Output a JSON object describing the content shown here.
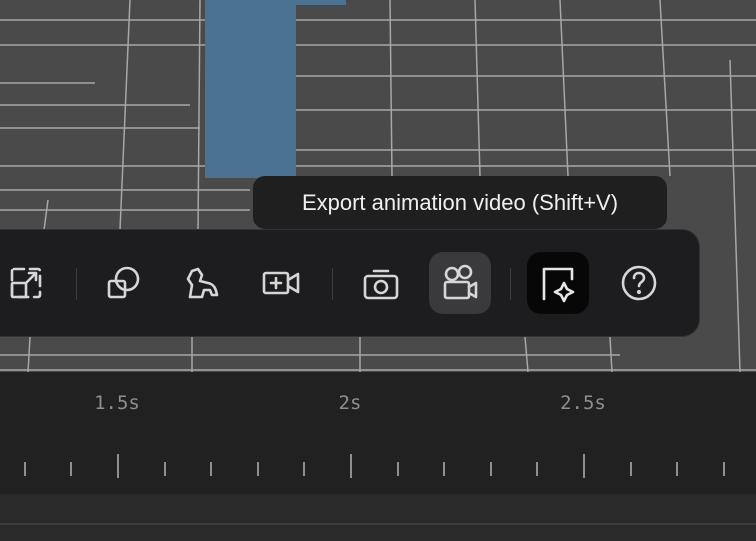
{
  "tooltip": {
    "text": "Export animation video (Shift+V)"
  },
  "toolbar": {
    "tools": [
      {
        "icon": "scale-icon"
      },
      {
        "icon": "shapes-icon"
      },
      {
        "icon": "horse-icon"
      },
      {
        "icon": "add-camera-icon"
      },
      {
        "icon": "camera-icon"
      },
      {
        "icon": "movie-camera-icon",
        "state": "hovered"
      },
      {
        "icon": "select-sparkle-icon",
        "state": "selected"
      },
      {
        "icon": "help-icon"
      }
    ]
  },
  "timeline": {
    "labels": [
      "1.5s",
      "2s",
      "2.5s"
    ]
  },
  "colors": {
    "viewport_bg": "#4a4a4a",
    "object_blue": "#4c7291",
    "toolbar_bg": "#1d1d1f",
    "tooltip_bg": "#1f1f1f",
    "timeline_bg": "#212122",
    "tick": "#8e8e93"
  }
}
